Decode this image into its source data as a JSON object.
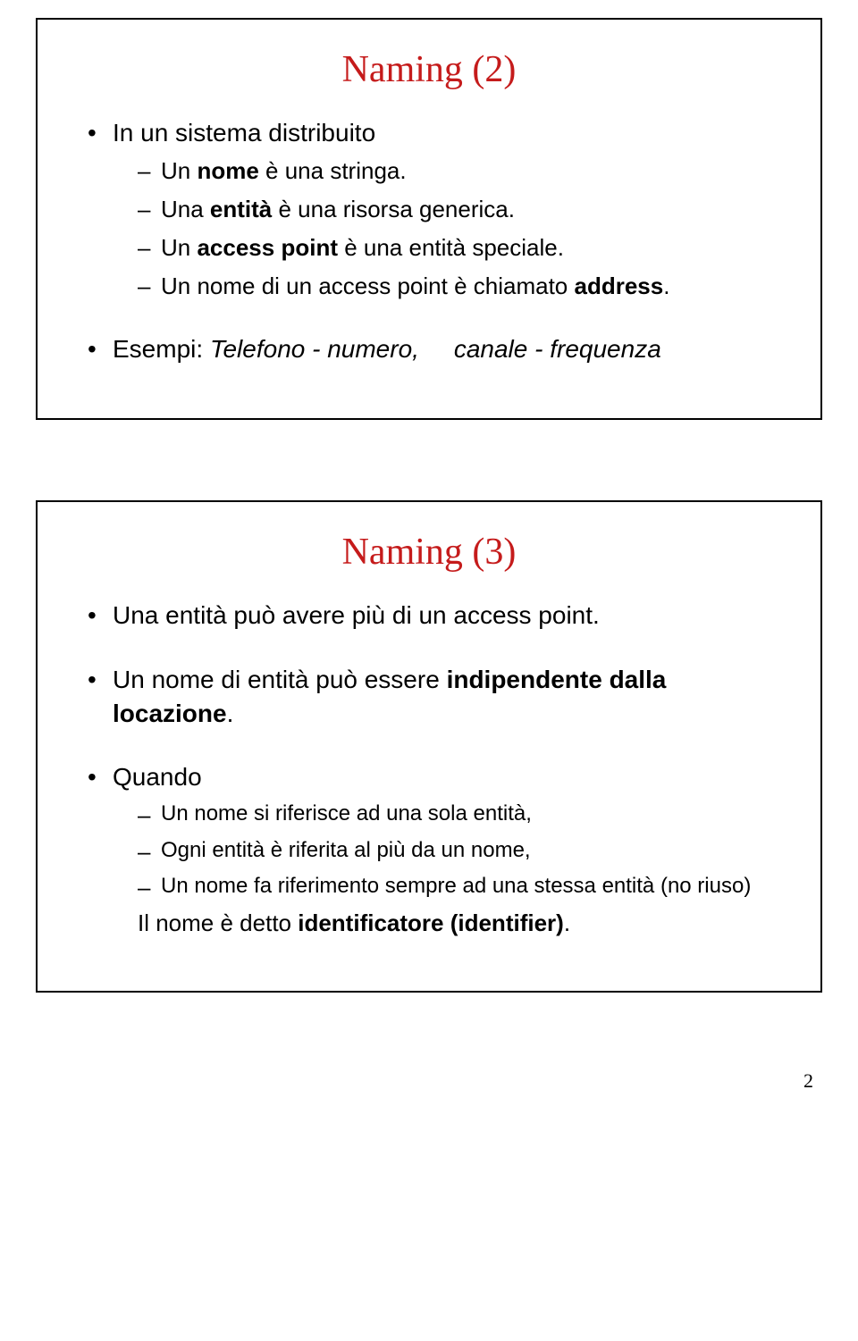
{
  "slide1": {
    "title": "Naming (2)",
    "b1_intro": "In un sistema distribuito",
    "s1_pre": "Un ",
    "s1_bold": "nome",
    "s1_post": " è una stringa.",
    "s2_pre": "Una ",
    "s2_bold": "entità",
    "s2_post": " è una risorsa generica.",
    "s3_pre": "Un ",
    "s3_bold": "access point",
    "s3_post": " è una entità speciale.",
    "s4_pre": "Un nome di un access point è chiamato ",
    "s4_bold": "address",
    "s4_post": ".",
    "b2_pre": "Esempi: ",
    "b2_italic1": "Telefono - numero,",
    "b2_gap": "     ",
    "b2_italic2": "canale - frequenza"
  },
  "slide2": {
    "title": "Naming (3)",
    "b1": "Una entità può avere più di un access point.",
    "b2_pre": "Un nome di entità può essere ",
    "b2_bold": "indipendente dalla locazione",
    "b2_post": ".",
    "b3_intro": "Quando",
    "s1": "Un nome si riferisce ad una sola entità,",
    "s2": "Ogni entità è riferita al più da un nome,",
    "s3": "Un nome fa riferimento sempre ad una stessa entità (no riuso)",
    "result_pre": "Il nome è detto ",
    "result_bold": "identificatore (identifier)",
    "result_post": "."
  },
  "page_number": "2"
}
